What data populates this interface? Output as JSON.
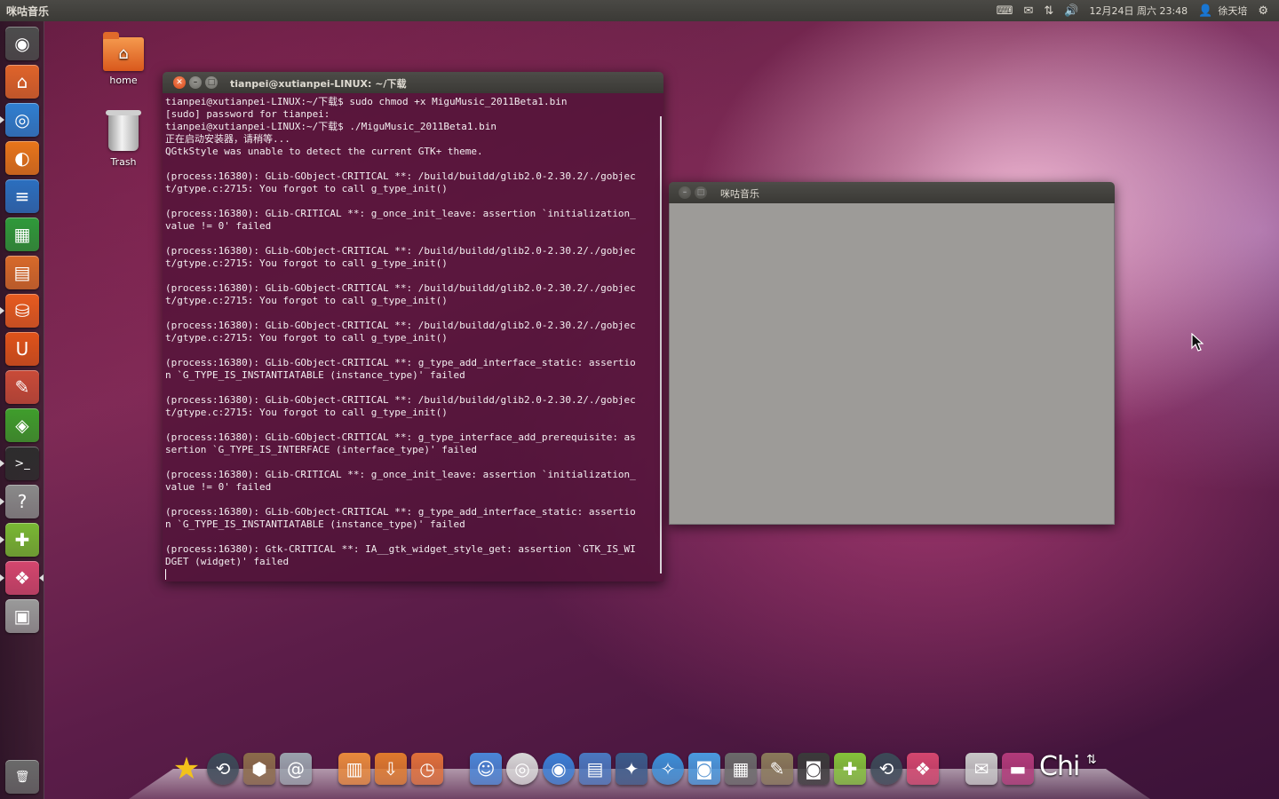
{
  "top_panel": {
    "app_title": "咪咕音乐",
    "tray": {
      "keyboard_icon": "keyboard-icon",
      "mail_icon": "mail-icon",
      "network_icon": "network-icon",
      "volume_icon": "volume-icon",
      "clock": "12月24日 周六 23:48",
      "user_name": "徐天培",
      "session_icon": "power-gear-icon"
    }
  },
  "desktop": {
    "icons": [
      {
        "label": "home",
        "icon": "home-folder-icon"
      },
      {
        "label": "Trash",
        "icon": "trash-icon"
      }
    ]
  },
  "launcher": {
    "items": [
      {
        "icon": "dash-home-icon",
        "color": "#4d4d4d",
        "glyph": "◉"
      },
      {
        "icon": "files-folder-icon",
        "color": "#e0642a",
        "glyph": "⌂"
      },
      {
        "icon": "chromium-icon",
        "color": "#2f7fd1",
        "glyph": "◎"
      },
      {
        "icon": "firefox-icon",
        "color": "#e8751a",
        "glyph": "◐"
      },
      {
        "icon": "writer-icon",
        "color": "#2b6fbf",
        "glyph": "≡"
      },
      {
        "icon": "calc-icon",
        "color": "#2f9a3a",
        "glyph": "▦"
      },
      {
        "icon": "impress-icon",
        "color": "#d86a2a",
        "glyph": "▤"
      },
      {
        "icon": "software-center-icon",
        "color": "#e85b1f",
        "glyph": "⛁"
      },
      {
        "icon": "ubuntu-one-icon",
        "color": "#e0531a",
        "glyph": "U"
      },
      {
        "icon": "system-settings-icon",
        "color": "#c94b38",
        "glyph": "✎"
      },
      {
        "icon": "workspace-icon",
        "color": "#3f9e2c",
        "glyph": "◈"
      },
      {
        "icon": "terminal-icon",
        "color": "#2d2d2d",
        "glyph": ">_"
      },
      {
        "icon": "help-icon",
        "color": "#8a8a8a",
        "glyph": "?"
      },
      {
        "icon": "android-icon",
        "color": "#79b833",
        "glyph": "✚"
      },
      {
        "icon": "package-icon",
        "color": "#d4466e",
        "glyph": "❖"
      },
      {
        "icon": "window-manager-icon",
        "color": "#9a9a9a",
        "glyph": "▣"
      },
      {
        "icon": "trash-icon",
        "color": "#6a6a6a",
        "glyph": "🗑"
      }
    ]
  },
  "terminal": {
    "title": "tianpei@xutianpei-LINUX: ~/下载",
    "lines": [
      "tianpei@xutianpei-LINUX:~/下载$ sudo chmod +x MiguMusic_2011Beta1.bin",
      "[sudo] password for tianpei:",
      "tianpei@xutianpei-LINUX:~/下载$ ./MiguMusic_2011Beta1.bin",
      "正在启动安装器，请稍等...",
      "QGtkStyle was unable to detect the current GTK+ theme.",
      "",
      "(process:16380): GLib-GObject-CRITICAL **: /build/buildd/glib2.0-2.30.2/./gobjec",
      "t/gtype.c:2715: You forgot to call g_type_init()",
      "",
      "(process:16380): GLib-CRITICAL **: g_once_init_leave: assertion `initialization_",
      "value != 0' failed",
      "",
      "(process:16380): GLib-GObject-CRITICAL **: /build/buildd/glib2.0-2.30.2/./gobjec",
      "t/gtype.c:2715: You forgot to call g_type_init()",
      "",
      "(process:16380): GLib-GObject-CRITICAL **: /build/buildd/glib2.0-2.30.2/./gobjec",
      "t/gtype.c:2715: You forgot to call g_type_init()",
      "",
      "(process:16380): GLib-GObject-CRITICAL **: /build/buildd/glib2.0-2.30.2/./gobjec",
      "t/gtype.c:2715: You forgot to call g_type_init()",
      "",
      "(process:16380): GLib-GObject-CRITICAL **: g_type_add_interface_static: assertio",
      "n `G_TYPE_IS_INSTANTIATABLE (instance_type)' failed",
      "",
      "(process:16380): GLib-GObject-CRITICAL **: /build/buildd/glib2.0-2.30.2/./gobjec",
      "t/gtype.c:2715: You forgot to call g_type_init()",
      "",
      "(process:16380): GLib-GObject-CRITICAL **: g_type_interface_add_prerequisite: as",
      "sertion `G_TYPE_IS_INTERFACE (interface_type)' failed",
      "",
      "(process:16380): GLib-CRITICAL **: g_once_init_leave: assertion `initialization_",
      "value != 0' failed",
      "",
      "(process:16380): GLib-GObject-CRITICAL **: g_type_add_interface_static: assertio",
      "n `G_TYPE_IS_INSTANTIATABLE (instance_type)' failed",
      "",
      "(process:16380): Gtk-CRITICAL **: IA__gtk_widget_style_get: assertion `GTK_IS_WI",
      "DGET (widget)' failed"
    ]
  },
  "migu_window": {
    "title": "咪咕音乐"
  },
  "dock": {
    "items": [
      {
        "icon": "favorites-star-icon",
        "color": "#f2c21b",
        "glyph": "★"
      },
      {
        "icon": "time-machine-icon",
        "color": "#3b4a57",
        "glyph": "⟲"
      },
      {
        "icon": "package-installer-icon",
        "color": "#8b6b4a",
        "glyph": "⬢"
      },
      {
        "icon": "mail-stamp-icon",
        "color": "#9aa3ad",
        "glyph": "@"
      },
      {
        "icon": "documents-folder-icon",
        "color": "#e98a3c",
        "glyph": "▥"
      },
      {
        "icon": "downloads-folder-icon",
        "color": "#e07a2c",
        "glyph": "⇩"
      },
      {
        "icon": "recent-folder-icon",
        "color": "#e0703a",
        "glyph": "◷"
      },
      {
        "icon": "finder-icon",
        "color": "#4a86d8",
        "glyph": "☺"
      },
      {
        "icon": "dvd-icon",
        "color": "#d8d8d8",
        "glyph": "◎"
      },
      {
        "icon": "chromium-icon",
        "color": "#3a7fd6",
        "glyph": "◉"
      },
      {
        "icon": "preview-icon",
        "color": "#4a78c0",
        "glyph": "▤"
      },
      {
        "icon": "preview-photo-icon",
        "color": "#3a5a8a",
        "glyph": "✦"
      },
      {
        "icon": "safari-icon",
        "color": "#3c8fd8",
        "glyph": "✧"
      },
      {
        "icon": "ichat-icon",
        "color": "#4a9ae0",
        "glyph": "◙"
      },
      {
        "icon": "calculator-icon",
        "color": "#6a6a6a",
        "glyph": "▦"
      },
      {
        "icon": "gimp-icon",
        "color": "#8a7a5a",
        "glyph": "✎"
      },
      {
        "icon": "camera-icon",
        "color": "#3a3a3a",
        "glyph": "◙"
      },
      {
        "icon": "android-icon",
        "color": "#84c23a",
        "glyph": "✚"
      },
      {
        "icon": "time-machine-icon",
        "color": "#3b4a57",
        "glyph": "⟲"
      },
      {
        "icon": "package-icon",
        "color": "#d4466e",
        "glyph": "❖"
      },
      {
        "icon": "mail-envelope-icon",
        "color": "#c8c8c8",
        "glyph": "✉"
      },
      {
        "icon": "wallpaper-icon",
        "color": "#b23a7a",
        "glyph": "▬"
      }
    ],
    "chi_text": "Chi",
    "arrows_icon": "network-arrows-icon"
  }
}
